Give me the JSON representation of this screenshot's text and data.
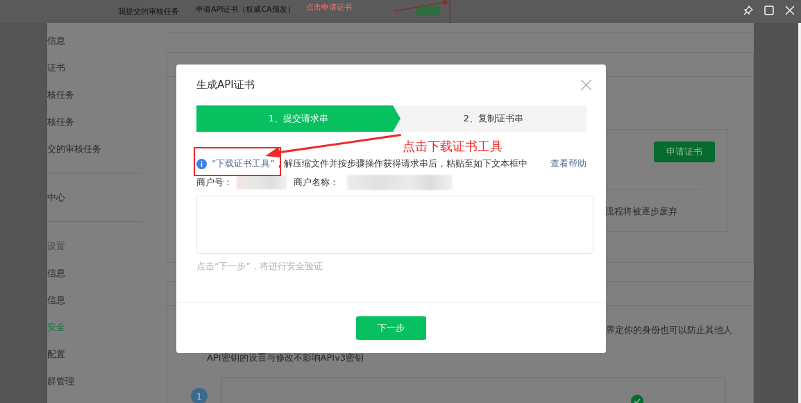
{
  "background_header": {
    "task_link": "我提交的审核任务",
    "cert_title": "申请API证书（权威CA颁发）",
    "annotation": "点击申请证书"
  },
  "sidebar": {
    "items": [
      {
        "kind": "item",
        "label": "信息",
        "selected": false
      },
      {
        "kind": "item",
        "label": "证书",
        "selected": false
      },
      {
        "kind": "item",
        "label": "核任务",
        "selected": false
      },
      {
        "kind": "item",
        "label": "核任务",
        "selected": false
      },
      {
        "kind": "item",
        "label": "交的审核任务",
        "selected": false
      },
      {
        "kind": "divider"
      },
      {
        "kind": "item",
        "label": "中心",
        "selected": false
      },
      {
        "kind": "divider"
      },
      {
        "kind": "header",
        "label": "设置"
      },
      {
        "kind": "item",
        "label": "信息",
        "selected": false
      },
      {
        "kind": "item",
        "label": "信息",
        "selected": false
      },
      {
        "kind": "item",
        "label": "安全",
        "selected": true
      },
      {
        "kind": "item",
        "label": "配置",
        "selected": false
      },
      {
        "kind": "item",
        "label": "群管理",
        "selected": false
      }
    ]
  },
  "content": {
    "apply_button": "申请证书",
    "deprecation_note": "流程将被逐步废弃",
    "identity_note": "界定你的身份也可以防止其他人",
    "key_note": "API密钥的设置与修改不影响APIv3密钥",
    "step_number": "1"
  },
  "dialog": {
    "title": "生成API证书",
    "steps": [
      {
        "label": "1、提交请求串",
        "selected": true
      },
      {
        "label": "2、复制证书串",
        "selected": false
      }
    ],
    "info_link": "“下载证书工具”",
    "info_text": "，解压缩文件并按步骤操作获得请求串后，粘贴至如下文本框中",
    "help_link": "查看帮助",
    "merchant_id_label": "商户号：",
    "merchant_name_label": "商户名称：",
    "hint": "点击“下一步”，将进行安全验证",
    "next_button": "下一步"
  },
  "annotation": {
    "label": "点击下载证书工具"
  }
}
